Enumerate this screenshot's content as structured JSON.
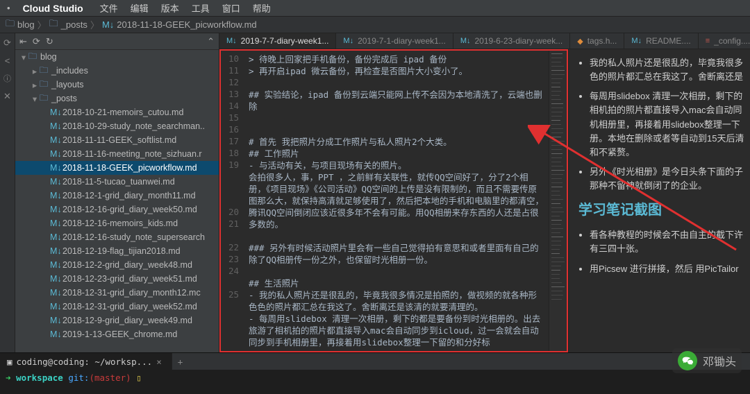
{
  "app": {
    "name": "Cloud Studio"
  },
  "menu": [
    "文件",
    "编辑",
    "版本",
    "工具",
    "窗口",
    "帮助"
  ],
  "breadcrumb": [
    {
      "icon": "folder",
      "label": "blog"
    },
    {
      "icon": "folder",
      "label": "_posts"
    },
    {
      "icon": "md",
      "label": "2018-11-18-GEEK_picworkflow.md"
    }
  ],
  "sidebar": {
    "tree": [
      {
        "depth": 0,
        "type": "folder",
        "open": true,
        "label": "blog"
      },
      {
        "depth": 1,
        "type": "folder",
        "open": false,
        "label": "_includes"
      },
      {
        "depth": 1,
        "type": "folder",
        "open": false,
        "label": "_layouts"
      },
      {
        "depth": 1,
        "type": "folder",
        "open": true,
        "label": "_posts"
      },
      {
        "depth": 2,
        "type": "md",
        "label": "2018-10-21-memoirs_cutou.md"
      },
      {
        "depth": 2,
        "type": "md",
        "label": "2018-10-29-study_note_searchman.."
      },
      {
        "depth": 2,
        "type": "md",
        "label": "2018-11-11-GEEK_softlist.md"
      },
      {
        "depth": 2,
        "type": "md",
        "label": "2018-11-16-meeting_note_sizhuan.r"
      },
      {
        "depth": 2,
        "type": "md",
        "label": "2018-11-18-GEEK_picworkflow.md",
        "selected": true
      },
      {
        "depth": 2,
        "type": "md",
        "label": "2018-11-5-tucao_tuanwei.md"
      },
      {
        "depth": 2,
        "type": "md",
        "label": "2018-12-1-grid_diary_month11.md"
      },
      {
        "depth": 2,
        "type": "md",
        "label": "2018-12-16-grid_diary_week50.md"
      },
      {
        "depth": 2,
        "type": "md",
        "label": "2018-12-16-memoirs_kids.md"
      },
      {
        "depth": 2,
        "type": "md",
        "label": "2018-12-16-study_note_supersearch"
      },
      {
        "depth": 2,
        "type": "md",
        "label": "2018-12-19-flag_tijian2018.md"
      },
      {
        "depth": 2,
        "type": "md",
        "label": "2018-12-2-grid_diary_week48.md"
      },
      {
        "depth": 2,
        "type": "md",
        "label": "2018-12-23-grid_diary_week51.md"
      },
      {
        "depth": 2,
        "type": "md",
        "label": "2018-12-31-grid_diary_month12.mc"
      },
      {
        "depth": 2,
        "type": "md",
        "label": "2018-12-31-grid_diary_week52.md"
      },
      {
        "depth": 2,
        "type": "md",
        "label": "2018-12-9-grid_diary_week49.md"
      },
      {
        "depth": 2,
        "type": "md",
        "label": "2019-1-13-GEEK_chrome.md"
      }
    ]
  },
  "tabs": [
    {
      "icon": "md",
      "label": "2019-7-7-diary-week1...",
      "active": true
    },
    {
      "icon": "md",
      "label": "2019-7-1-diary-week1..."
    },
    {
      "icon": "md",
      "label": "2019-6-23-diary-week..."
    },
    {
      "icon": "html",
      "label": "tags.h..."
    },
    {
      "icon": "md",
      "label": "README...."
    },
    {
      "icon": "yml",
      "label": "_config...."
    }
  ],
  "editor": {
    "first_line_no": 10,
    "lines": [
      "> 待晚上回家把手机备份，备份完成后 ipad 备份",
      "> 再开启ipad 微云备份，再检查是否图片大小变小了。",
      "",
      "## 实验结论，ipad 备份到云端只能网上传不会因为本地清洗了，云端也删除",
      "",
      "",
      "# 首先 我把照片分成工作照片与私人照片2个大类。",
      "## 工作照片",
      "- 与活动有关，与项目现场有关的照片。",
      "会拍很多人，事，PPT ，之前鲜有关联性，就传QQ空间好了，分了2个相册，《项目现场》《公司活动》QQ空间的上传是没有限制的，而且不需要传原图那么大，就保持高清就足够使用了，然后把本地的手机和电脑里的都清空，腾讯QQ空间倒闭应该近很多年不会有可能。用QQ相册来存东西的人还是占很多数的。",
      "",
      "### 另外有时候活动照片里会有一些自己觉得拍有意思和或者里面有自己的除了QQ相册传一份之外，也保留时光相册一份。",
      "",
      "## 生活照片",
      "- 我的私人照片还是很乱的，毕竟我很多情况是拍照的，做视频的就各种形色色的照片都汇总在我这了。舍断离还是该清的就要清理的。",
      "- 每周用slidebox 清理一次相册，剩下的都是要备份到时光相册的。出去旅游了相机拍的照片都直接导入mac会自动同步到icloud，过一会就会自动同步到手机相册里，再接着用slidebox整理一下留的和分好标"
    ]
  },
  "preview": {
    "bullets1": [
      "我的私人照片还是很乱的，毕竟我很多色的照片都汇总在我这了。舍断离还是",
      "每周用slidebox 清理一次相册，剩下的相机拍的照片都直接导入mac会自动同机相册里，再接着用slidebox整理一下册。本地在删除或者等自动到15天后清和不紧赘。",
      "另外《时光相册》是今日头条下面的子那种不留神就倒闭了的企业。"
    ],
    "heading": "学习笔记截图",
    "bullets2": [
      "看各种教程的时候会不由自主的截下许有三四十张。",
      "用Picsew 进行拼接，然后 用PicTailor"
    ]
  },
  "terminal": {
    "tab": "coding@coding: ~/worksp...",
    "prompt": {
      "workspace": "workspace",
      "git": "git:",
      "branch": "master"
    }
  },
  "watermark": {
    "text": "邓锄头"
  }
}
